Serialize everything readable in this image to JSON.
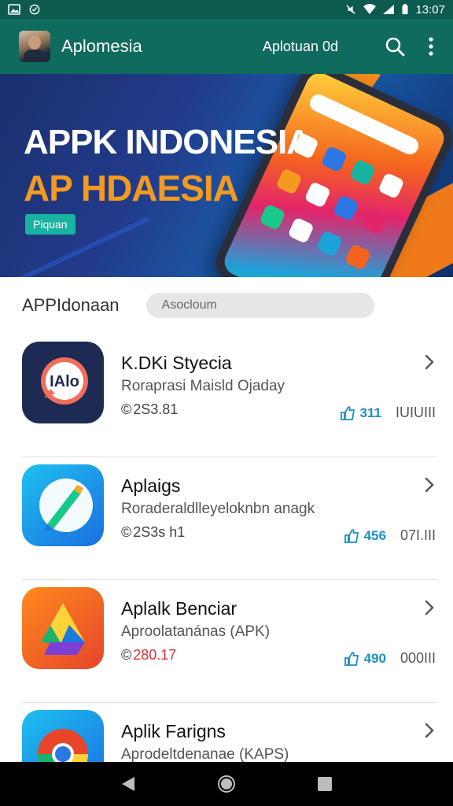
{
  "status_bar": {
    "time": "13:07"
  },
  "app_bar": {
    "title": "Aplomesia",
    "subtitle": "Aplotuan 0d",
    "search_icon": "search-icon",
    "menu_icon": "more-vert-icon"
  },
  "banner": {
    "title_line1": "APPK INDONESIA",
    "title_line2": "AP HDAESIA",
    "button_label": "Piquan",
    "colors": {
      "bg": "#1b2f6e",
      "accent": "#f39a21",
      "button": "#18b3a1"
    }
  },
  "section": {
    "title": "APPIdonaan",
    "search_placeholder": "Asocloum"
  },
  "apps": [
    {
      "name": "K.DKi Styecia",
      "desc": "Roraprasi Maisld Ojaday",
      "size": "2S3.81",
      "likes": "311",
      "unit": "IUIUIII",
      "icon": "chat-bubble-icon"
    },
    {
      "name": "Aplaigs",
      "desc": "Roraderaldlleyeloknbn anagk",
      "size": "2S3s h1",
      "likes": "456",
      "unit": "07I.III",
      "icon": "pen-icon"
    },
    {
      "name": "Aplalk Benciar",
      "desc": "Aproolatanánas (APK)",
      "size": "280.17",
      "likes": "490",
      "unit": "000III",
      "icon": "drive-icon"
    },
    {
      "name": "Aplik Farigns",
      "desc": "Aprodeltdenanae (KAPS)",
      "size": "",
      "likes": "",
      "unit": "",
      "icon": "chrome-icon"
    }
  ],
  "nav_bar": {
    "back": "back-icon",
    "home": "home-icon",
    "recents": "recents-icon"
  }
}
